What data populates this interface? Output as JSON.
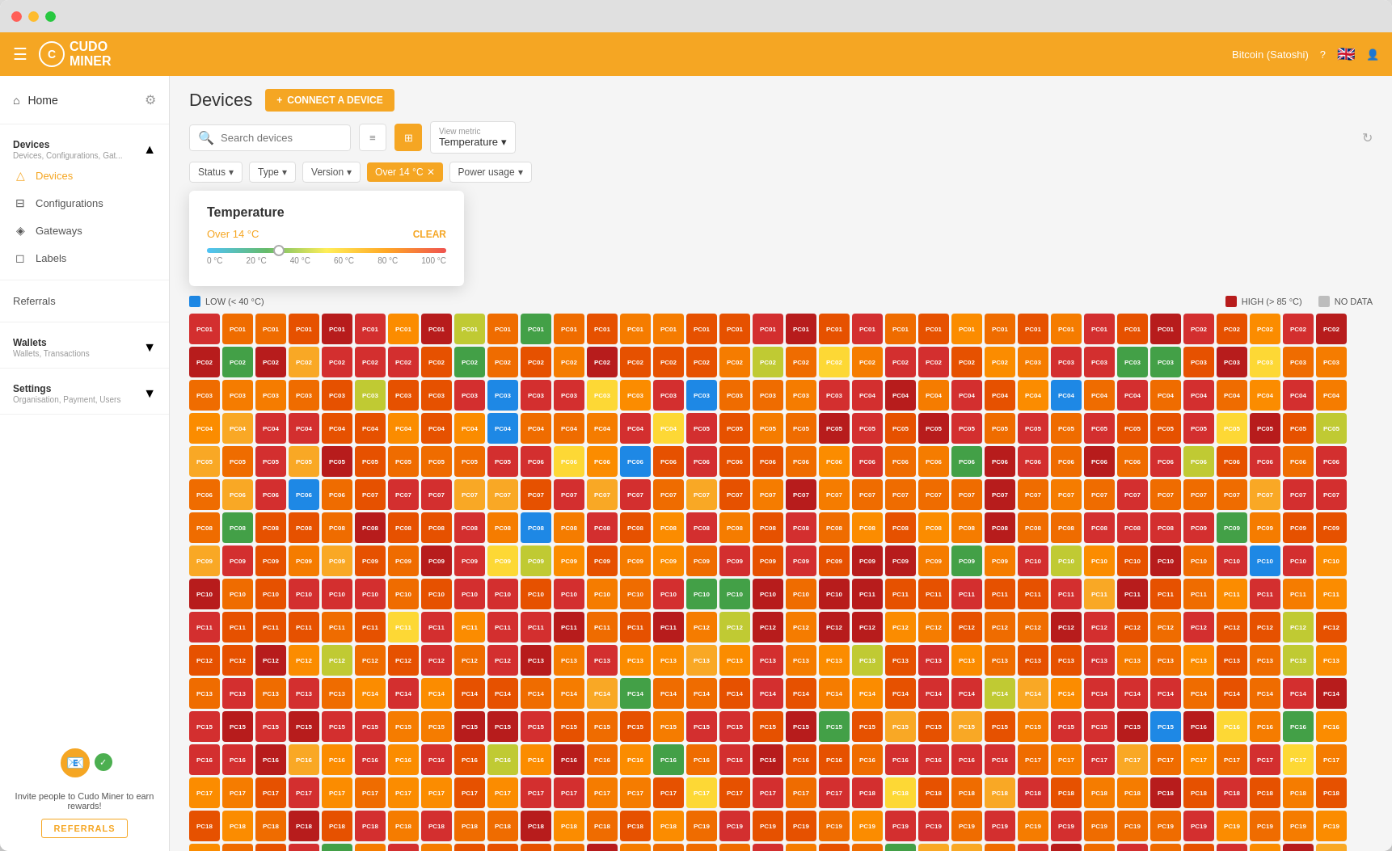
{
  "window": {
    "titlebar_btns": [
      "red",
      "yellow",
      "green"
    ]
  },
  "topnav": {
    "logo_text": "CUDO\nMINER",
    "currency": "Bitcoin (Satoshi)",
    "help_icon": "?",
    "flag_icon": "🇬🇧"
  },
  "sidebar": {
    "home_label": "Home",
    "settings_icon": "⚙",
    "devices_group": {
      "title": "Devices",
      "subtitle": "Devices, Configurations, Gat...",
      "items": [
        {
          "label": "Devices",
          "icon": "△",
          "active": true
        },
        {
          "label": "Configurations",
          "icon": "≡"
        },
        {
          "label": "Gateways",
          "icon": "◈"
        },
        {
          "label": "Labels",
          "icon": "◻"
        }
      ]
    },
    "referrals_label": "Referrals",
    "wallets_group": {
      "title": "Wallets",
      "subtitle": "Wallets, Transactions"
    },
    "settings_group": {
      "title": "Settings",
      "subtitle": "Organisation, Payment, Users"
    },
    "referral_cta": "Invite people to Cudo Miner to earn rewards!",
    "referral_btn": "REFERRALS"
  },
  "content": {
    "page_title": "Devices",
    "connect_btn": "CONNECT A DEVICE",
    "search_placeholder": "Search devices",
    "view_metric_label": "View metric",
    "view_metric_value": "Temperature",
    "filters": {
      "status": "Status",
      "type": "Type",
      "version": "Version",
      "active_filter": "Over 14 °C",
      "power_usage": "Power usage"
    },
    "legend": {
      "low_label": "LOW (< 40 °C)",
      "high_label": "HIGH (> 85 °C)",
      "no_data_label": "NO DATA"
    },
    "temp_popup": {
      "title": "Temperature",
      "filter_label": "Over 14 °C",
      "clear_label": "CLEAR",
      "slider_labels": [
        "0 °C",
        "20 °C",
        "40 °C",
        "60 °C",
        "80 °C",
        "100 °C"
      ]
    }
  },
  "device_colors": {
    "colors": {
      "c-red": "#d32f2f",
      "c-orange": "#e65100",
      "c-amber": "#f57c00",
      "c-yellow": "#f9a825",
      "c-lime": "#c0ca33",
      "c-green": "#43a047"
    }
  }
}
